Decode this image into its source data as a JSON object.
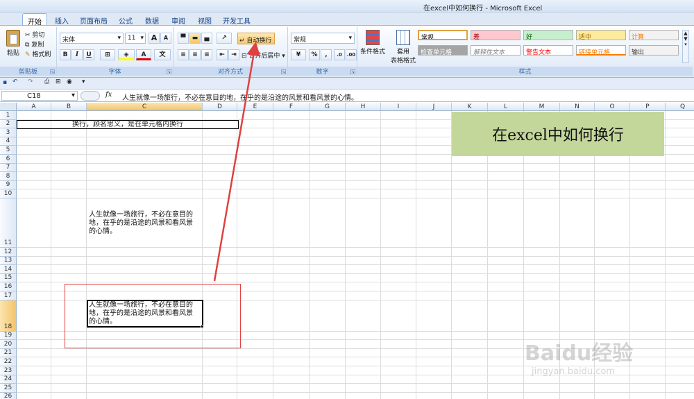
{
  "window": {
    "title": "在excel中如何换行 - Microsoft Excel"
  },
  "tabs": [
    "开始",
    "插入",
    "页面布局",
    "公式",
    "数据",
    "审阅",
    "视图",
    "开发工具"
  ],
  "clipboard": {
    "paste": "粘贴",
    "cut": "剪切",
    "copy": "复制",
    "format_painter": "格式刷",
    "label": "剪贴板"
  },
  "font": {
    "name": "宋体",
    "size": "11",
    "grow": "A",
    "shrink": "A",
    "bold": "B",
    "italic": "I",
    "underline": "U",
    "label": "字体"
  },
  "alignment": {
    "wrap_text": "自动换行",
    "merge_center": "合并后居中",
    "label": "对齐方式"
  },
  "number": {
    "format": "常规",
    "percent": "%",
    "comma": ",",
    "label": "数字"
  },
  "styles": {
    "conditional": "条件格式",
    "table_format_line1": "套用",
    "table_format_line2": "表格格式",
    "cells": [
      {
        "label": "常规",
        "bg": "#ffffff",
        "fg": "#000000"
      },
      {
        "label": "差",
        "bg": "#ffc7ce",
        "fg": "#9c0006"
      },
      {
        "label": "好",
        "bg": "#c6efce",
        "fg": "#006100"
      },
      {
        "label": "适中",
        "bg": "#ffeb9c",
        "fg": "#9c6500"
      },
      {
        "label": "计算",
        "bg": "#f2f2f2",
        "fg": "#fa7d00"
      },
      {
        "label": "检查单元格",
        "bg": "#a5a5a5",
        "fg": "#ffffff"
      },
      {
        "label": "解释性文本",
        "bg": "#ffffff",
        "fg": "#7f7f7f"
      },
      {
        "label": "警告文本",
        "bg": "#ffffff",
        "fg": "#ff0000"
      },
      {
        "label": "链接单元格",
        "bg": "#ffffff",
        "fg": "#fa7d00"
      },
      {
        "label": "输出",
        "bg": "#f2f2f2",
        "fg": "#3f3f3f"
      }
    ],
    "label": "样式"
  },
  "formula_bar": {
    "cell_ref": "C18",
    "fx": "fx",
    "content": "人生就像一场旅行，不必在意目的地，在乎的是沿途的风景和看风景的心情。"
  },
  "sheet": {
    "columns": [
      "A",
      "B",
      "C",
      "D",
      "E",
      "F",
      "G",
      "H",
      "I",
      "J",
      "K",
      "L",
      "M",
      "N",
      "O",
      "P",
      "Q"
    ],
    "rows": [
      "1",
      "2",
      "3",
      "4",
      "5",
      "6",
      "7",
      "8",
      "9",
      "10",
      "11",
      "12",
      "13",
      "14",
      "15",
      "16",
      "17",
      "18",
      "19",
      "20",
      "21",
      "22",
      "23",
      "24",
      "25",
      "26"
    ],
    "b2_text": "换行，顾名思义，是在单元格内换行",
    "c11_lines": [
      "人生就像一场旅行，不必在意目的",
      "地，在乎的是沿途的风景和看风景",
      "的心情。"
    ],
    "c18_lines": [
      "人生就像一场旅行，不必在意目的",
      "地，在乎的是沿途的风景和看风景",
      "的心情。"
    ],
    "banner": {
      "text": "在excel中如何换行",
      "bg": "#c4d79b"
    }
  },
  "watermark": {
    "brand": "Baidu经验",
    "url": "jingyan.baidu.com"
  },
  "accent": {
    "annotation": "#e04040",
    "selection": "#f4c36a"
  }
}
